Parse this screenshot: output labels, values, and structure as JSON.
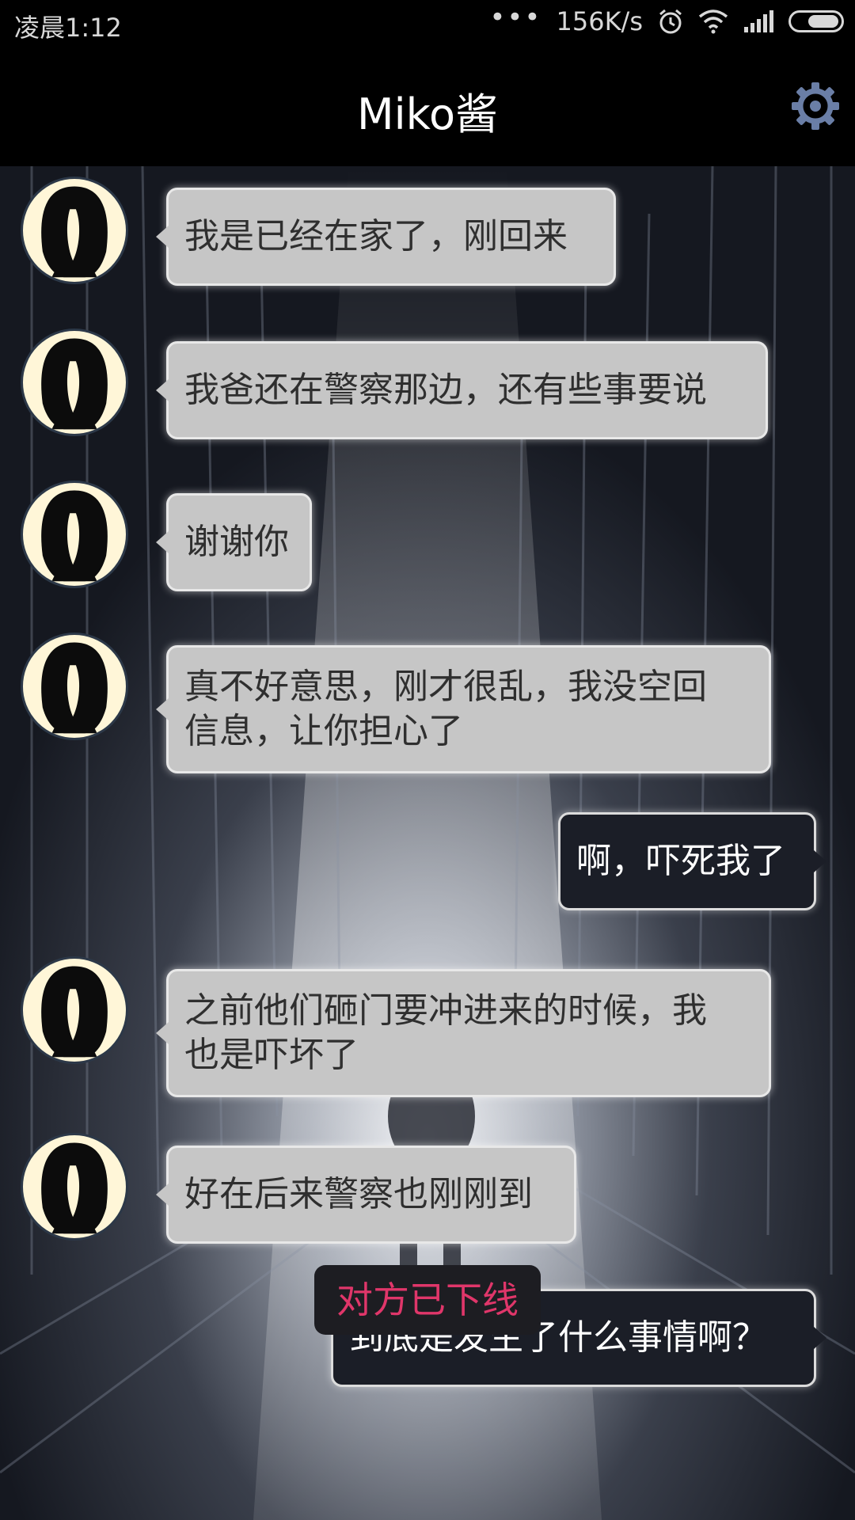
{
  "status_bar": {
    "time": "凌晨1:12",
    "dots": "•••",
    "speed": "156K/s",
    "icons": [
      "alarm-icon",
      "wifi-icon",
      "signal-icon",
      "battery-icon"
    ]
  },
  "header": {
    "title": "Miko酱",
    "settings_icon": "gear-icon",
    "accent": "#6a7ea6"
  },
  "messages": [
    {
      "from": "other",
      "text": "我是已经在家了，刚回来"
    },
    {
      "from": "other",
      "text": "我爸还在警察那边，还有些事要说"
    },
    {
      "from": "other",
      "text": "谢谢你"
    },
    {
      "from": "other",
      "lines": [
        "真不好意思，刚才很乱，我没空回",
        "信息，让你担心了"
      ]
    },
    {
      "from": "me",
      "text": "啊，吓死我了"
    },
    {
      "from": "other",
      "lines": [
        "之前他们砸门要冲进来的时候，我",
        "也是吓坏了"
      ]
    },
    {
      "from": "other",
      "text": "好在后来警察也刚刚到"
    },
    {
      "from": "me",
      "text": "到底是发生了什么事情啊？"
    }
  ],
  "footer": {
    "status": "对方已下线",
    "status_color": "#e0366a"
  }
}
